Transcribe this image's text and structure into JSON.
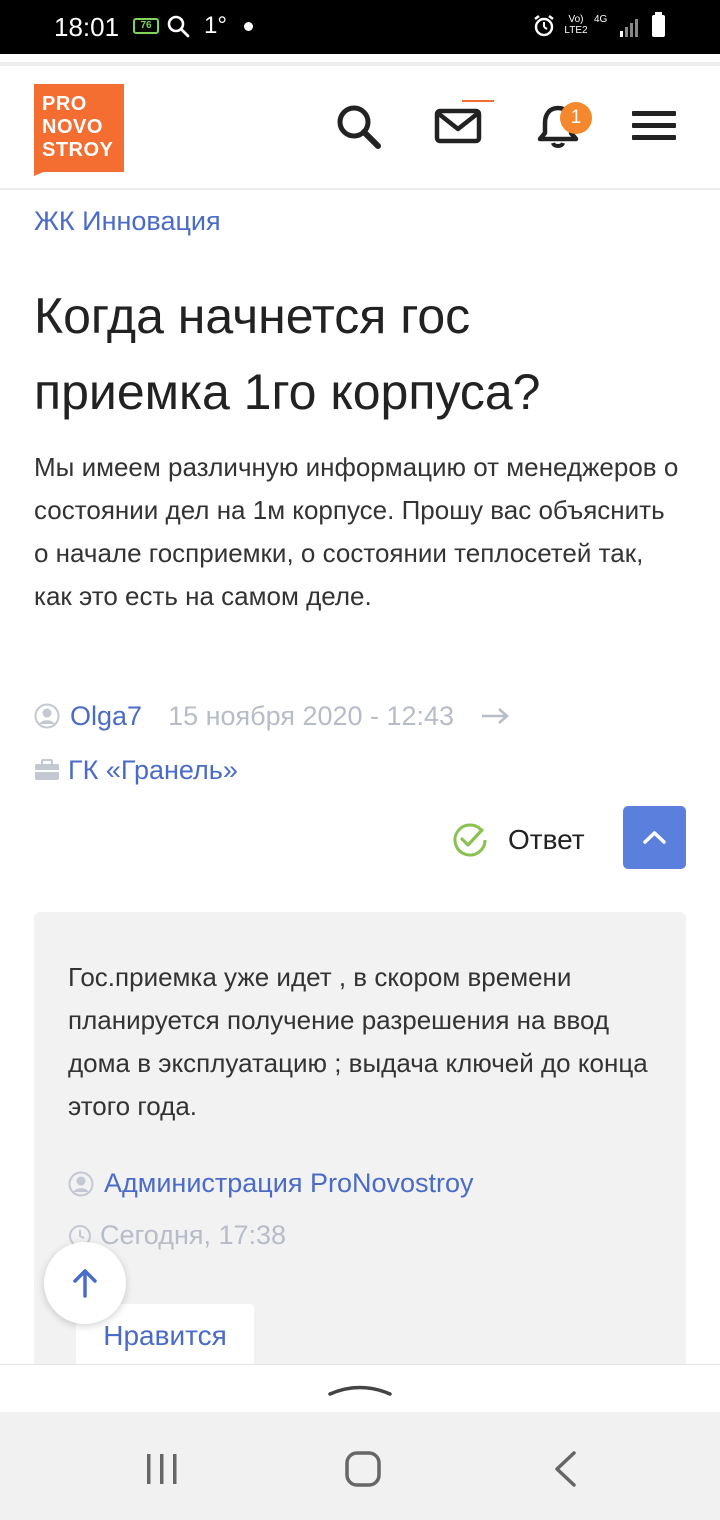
{
  "status_bar": {
    "time": "18:01",
    "battery_badge": "76",
    "temperature": "1°",
    "lte_label": "Vo) LTE2",
    "network_label": "4G"
  },
  "header": {
    "logo_lines": [
      "PRO",
      "NOVO",
      "STROY"
    ],
    "notification_count": "1",
    "accent_color": "#f46d31"
  },
  "breadcrumb": "ЖК Инновация",
  "question": {
    "title": "Когда начнется гос приемка 1го корпуса?",
    "body": "Мы имеем различную информацию от менеджеров о состоянии дел на 1м корпусе. Прошу вас объяснить о начале госприемки, о состоянии теплосетей так, как это есть на самом деле.",
    "author": "Olga7",
    "date": "15 ноября 2020 - 12:43",
    "company": "ГК «Гранель»"
  },
  "answer_status": "Ответ",
  "answer": {
    "text": "Гос.приемка уже идет , в скором времени планируется получение разрешения на ввод дома в эксплуатацию ; выдача ключей до конца этого года.",
    "author": "Администрация ProNovostroy",
    "date": "Сегодня, 17:38",
    "like_label": "Нравится"
  },
  "colors": {
    "link": "#4a6bc8",
    "muted": "#b8bcc8",
    "primary_button": "#5b7fdc",
    "check": "#8cc152"
  }
}
